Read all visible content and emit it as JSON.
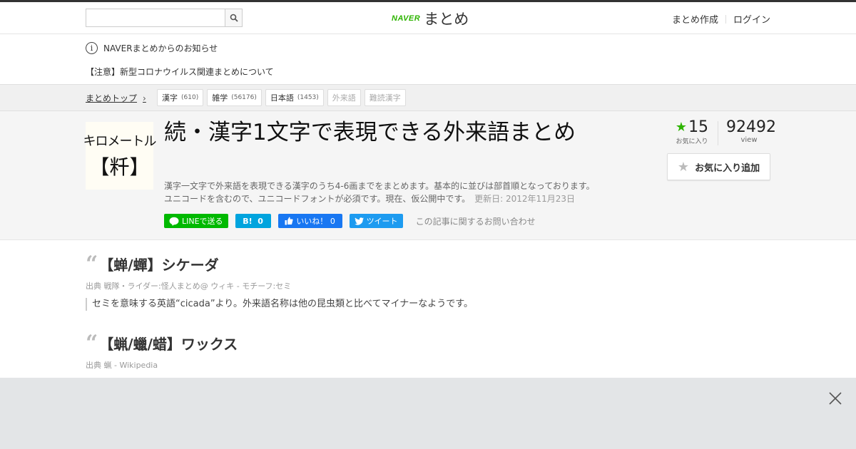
{
  "header": {
    "search_placeholder": "",
    "logo_brand": "NAVER",
    "logo_name": "まとめ",
    "nav_create": "まとめ作成",
    "nav_login": "ログイン"
  },
  "notice": {
    "title": "NAVERまとめからのお知らせ",
    "item": "【注意】新型コロナウイルス関連まとめについて"
  },
  "breadcrumb": {
    "top_label": "まとめトップ",
    "tags": [
      {
        "label": "漢字",
        "count": "(610)"
      },
      {
        "label": "雑学",
        "count": "(56176)"
      },
      {
        "label": "日本語",
        "count": "(1453)"
      },
      {
        "label": "外来語",
        "count": ""
      },
      {
        "label": "難読漢字",
        "count": ""
      }
    ]
  },
  "article": {
    "thumb_line1": "キロメートル",
    "thumb_line2": "【粁】",
    "title": "続・漢字1文字で表現できる外来語まとめ",
    "desc_line1": "漢字一文字で外来語を表現できる漢字のうち4-6画までをまとめます。基本的に並びは部首順となっております。",
    "desc_line2": "ユニコードを含むので、ユニコードフォントが必須です。現在、仮公開中です。",
    "updated": "更新日: 2012年11月23日",
    "favorites_count": "15",
    "favorites_label": "お気に入り",
    "views_count": "92492",
    "views_label": "view",
    "fav_button": "お気に入り追加",
    "social": {
      "line": "LINEで送る",
      "hatena_icon": "B!",
      "hatena_count": "0",
      "fb_label": "いいね！",
      "fb_count": "0",
      "tweet": "ツイート"
    },
    "contact": "この記事に関するお問い合わせ"
  },
  "items": [
    {
      "heading": "【蝉/蟬】シケーダ",
      "source": "出典 戦隊・ライダー:怪人まとめ@ ウィキ - モチーフ:セミ",
      "body": "セミを意味する英語“cicada”より。外来語名称は他の昆虫類と比べてマイナーなようです。"
    },
    {
      "heading": "【蝋/蠟/蜡】ワックス",
      "source": "出典 蝋 - Wikipedia",
      "body": ""
    }
  ],
  "icons": {
    "search": "search-icon",
    "info": "info-icon",
    "chevron": "chevron-right-icon",
    "star": "star-icon",
    "close": "close-icon"
  },
  "colors": {
    "naver_green": "#2db400",
    "line_green": "#00b900",
    "hatena_blue": "#00a4de",
    "facebook_blue": "#1877f2",
    "twitter_blue": "#1d9bf0"
  }
}
